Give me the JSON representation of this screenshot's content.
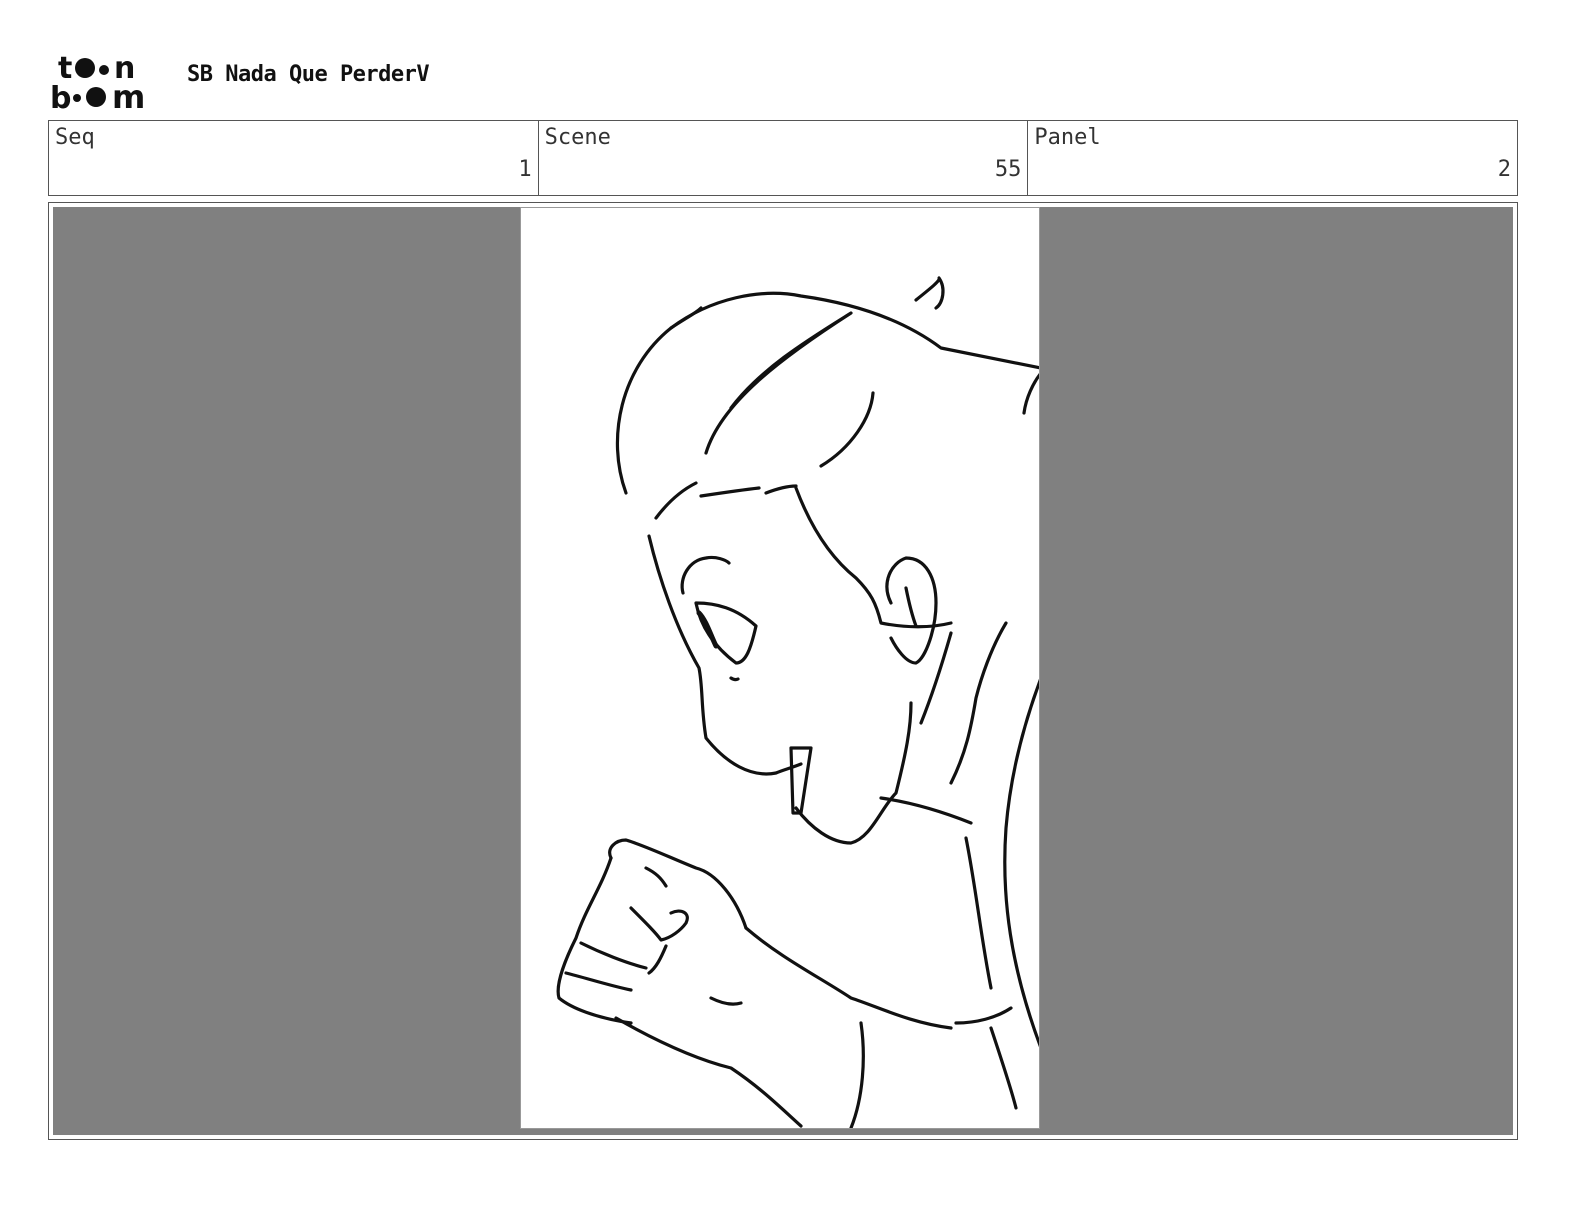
{
  "header": {
    "logo_text": "toon boom",
    "project_title": "SB Nada Que PerderV"
  },
  "info": {
    "seq": {
      "label": "Seq",
      "value": "1"
    },
    "scene": {
      "label": "Scene",
      "value": "55"
    },
    "panel": {
      "label": "Panel",
      "value": "2"
    }
  },
  "colors": {
    "panel_background": "#808080",
    "drawing_background": "#ffffff",
    "line": "#111111"
  }
}
